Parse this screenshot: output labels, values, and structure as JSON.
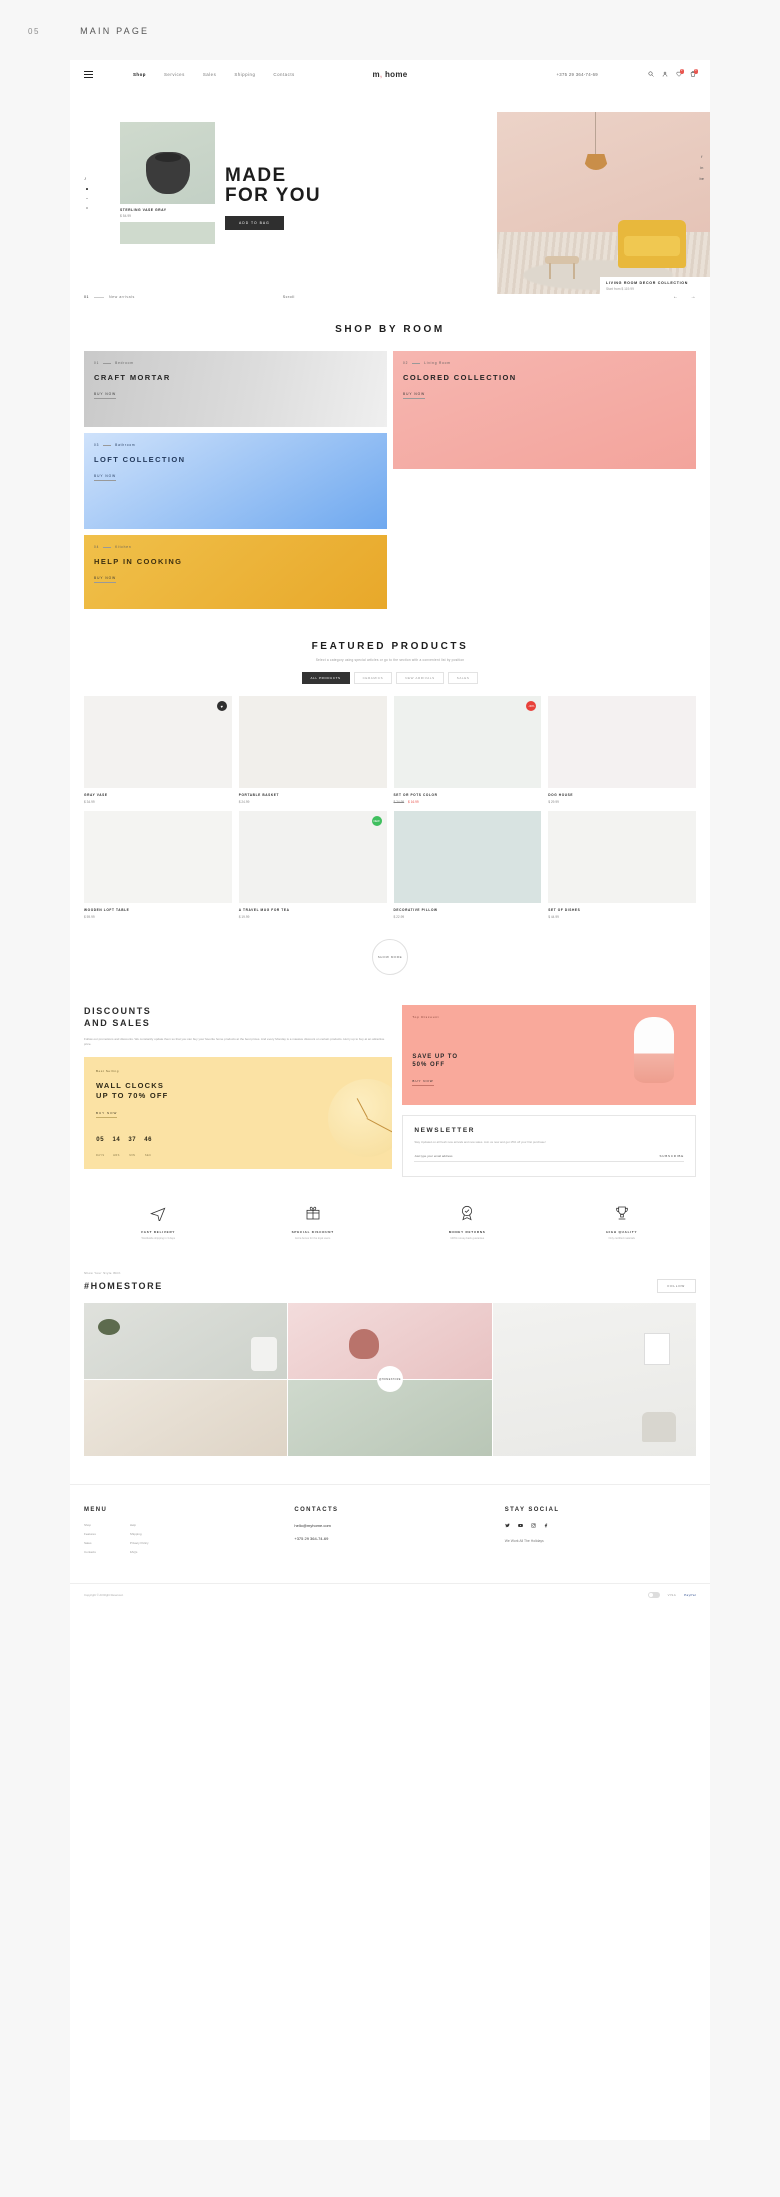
{
  "slide": {
    "number": "05",
    "title": "MAIN PAGE"
  },
  "nav": {
    "links": [
      {
        "label": "Shop",
        "active": true
      },
      {
        "label": "Services",
        "active": false
      },
      {
        "label": "Sales",
        "active": false
      },
      {
        "label": "Shipping",
        "active": false
      },
      {
        "label": "Contacts",
        "active": false
      }
    ],
    "logo": "m home",
    "phone": "+375 29 364-74-69",
    "icons": [
      "search-icon",
      "user-icon",
      "heart-icon",
      "bag-icon"
    ],
    "heart_badge": "2",
    "bag_badge": "3"
  },
  "hero": {
    "headline_line1": "MADE",
    "headline_line2": "FOR YOU",
    "cta": "ADD TO BAG",
    "product": {
      "name": "STERLING VASE GRAY",
      "price": "$ 54.99"
    },
    "caption": {
      "title": "LIVING ROOM DECOR COLLECTION",
      "sub": "Start from $ 119.99"
    },
    "socials": [
      "f",
      "in",
      "be"
    ]
  },
  "strip": {
    "index": "01",
    "label": "New arrivals",
    "scroll": "Scroll",
    "prev": "←",
    "next": "→"
  },
  "rooms": {
    "title": "SHOP BY ROOM",
    "cards": [
      {
        "num": "01",
        "cat": "Bedroom",
        "title": "CRAFT MORTAR",
        "cta": "BUY NOW"
      },
      {
        "num": "02",
        "cat": "Living Room",
        "title": "COLORED COLLECTION",
        "cta": "BUY NOW"
      },
      {
        "num": "03",
        "cat": "Bathroom",
        "title": "LOFT COLLECTION",
        "cta": "BUY NOW"
      },
      {
        "num": "04",
        "cat": "Kitchen",
        "title": "HELP IN COOKING",
        "cta": "BUY NOW"
      }
    ]
  },
  "featured": {
    "title": "FEATURED PRODUCTS",
    "subtitle": "Select a category using special articles or go to the section with a convenient list by position",
    "filters": [
      {
        "label": "ALL PRODUCTS",
        "active": true
      },
      {
        "label": "CERAMICS",
        "active": false
      },
      {
        "label": "NEW ARRIVALS",
        "active": false
      },
      {
        "label": "SALES",
        "active": false
      }
    ],
    "items": [
      {
        "name": "GRAY VASE",
        "price": "$ 34.99",
        "old": "",
        "new": "",
        "badge": "",
        "badge_type": "",
        "fav": true
      },
      {
        "name": "PORTABLE BASKET",
        "price": "$ 24.99",
        "old": "",
        "new": "",
        "badge": "",
        "badge_type": "",
        "fav": false
      },
      {
        "name": "SET OR POTS COLOR",
        "price": "",
        "old": "$ 24.99",
        "new": "$ 16.99",
        "badge": "-30%",
        "badge_type": "red",
        "fav": false
      },
      {
        "name": "DOG HOUSE",
        "price": "$ 29.99",
        "old": "",
        "new": "",
        "badge": "",
        "badge_type": "",
        "fav": false
      },
      {
        "name": "WOODEN LOFT TABLE",
        "price": "$ 59.99",
        "old": "",
        "new": "",
        "badge": "",
        "badge_type": "",
        "fav": false
      },
      {
        "name": "A TRAVEL MUG FOR TEA",
        "price": "$ 19.99",
        "old": "",
        "new": "",
        "badge": "NEW",
        "badge_type": "green",
        "fav": false
      },
      {
        "name": "DECORATIVE PILLOW",
        "price": "$ 22.99",
        "old": "",
        "new": "",
        "badge": "",
        "badge_type": "",
        "fav": false
      },
      {
        "name": "SET OF DISHES",
        "price": "$ 44.99",
        "old": "",
        "new": "",
        "badge": "",
        "badge_type": "",
        "fav": false
      }
    ],
    "show_more": "SHOW MORE"
  },
  "discounts": {
    "title_line1": "DISCOUNTS",
    "title_line2": "AND SALES",
    "text": "Follow our promotions and discounts. We constantly update them so that you can buy your favorite home products at the best prices. And every Monday is a massive discount on certain products. Hurry up to buy at an attractive price.",
    "sale_card": {
      "tag": "Top Discount",
      "line1": "SAVE UP TO",
      "line2": "50% OFF",
      "cta": "BUY NOW"
    },
    "clock_card": {
      "tag": "Best Selling",
      "line1": "WALL CLOCKS",
      "line2": "UP TO 70% OFF",
      "cta": "BUY NOW",
      "counter": [
        {
          "value": "05",
          "unit": "DAYS"
        },
        {
          "value": "14",
          "unit": "HRS"
        },
        {
          "value": "37",
          "unit": "MIN"
        },
        {
          "value": "46",
          "unit": "SEC"
        }
      ]
    },
    "newsletter": {
      "title": "NEWSLETTER",
      "text": "Stay Updated on all fresh new arrivals and new sales. Join us now and get 15% off your first purchase!",
      "placeholder": "Just type your email address",
      "button": "SUBSCRIBE"
    }
  },
  "features": [
    {
      "icon": "plane-icon",
      "title": "FAST DELIVERY",
      "sub": "Worldwide shipping in 3 days"
    },
    {
      "icon": "gift-icon",
      "title": "SPECIAL DISCOUNT",
      "sub": "Extra bonus for the loyal users"
    },
    {
      "icon": "badge-icon",
      "title": "MONEY RETURNS",
      "sub": "100% money-back guarantee"
    },
    {
      "icon": "trophy-icon",
      "title": "HIGH QUALITY",
      "sub": "Only certified materials"
    }
  ],
  "homestore": {
    "small": "Show Your Style With",
    "title": "#HOMESTORE",
    "button": "FOLLOW",
    "badge": "@HOMESTORE"
  },
  "footer": {
    "menu": {
      "title": "MENU",
      "col1": [
        "Shop",
        "Features",
        "Sales",
        "Contacts"
      ],
      "col2": [
        "Help",
        "Shipping",
        "Privacy Policy",
        "FAQs"
      ]
    },
    "contacts": {
      "title": "CONTACTS",
      "email": "hello@myhome.com",
      "phone": "+375 29 364-74-69"
    },
    "social": {
      "title": "STAY SOCIAL",
      "icons": [
        "twitter-icon",
        "youtube-icon",
        "instagram-icon",
        "facebook-icon"
      ],
      "note": "We Work All The Holidays"
    },
    "copyright": "Copyright © All Right Reserved.",
    "pay": [
      "VISA",
      "PayPal"
    ]
  }
}
